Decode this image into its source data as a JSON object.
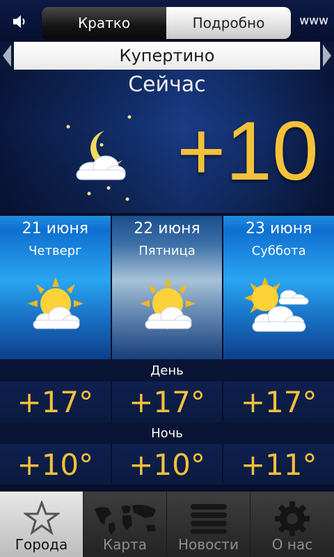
{
  "header": {
    "segments": [
      {
        "label": "Кратко",
        "active": true
      },
      {
        "label": "Подробно",
        "active": false
      }
    ],
    "www_label": "www",
    "sound_icon": "speaker-icon"
  },
  "city": "Купертино",
  "now": {
    "label": "Сейчас",
    "temperature": "+10",
    "icon": "moon-cloud-icon"
  },
  "forecast": [
    {
      "date": "21 июня",
      "weekday": "Четверг",
      "icon": "sun-cloud-icon",
      "selected": false
    },
    {
      "date": "22 июня",
      "weekday": "Пятница",
      "icon": "sun-cloud-icon",
      "selected": true
    },
    {
      "date": "23 июня",
      "weekday": "Суббота",
      "icon": "sun-clouds-icon",
      "selected": false
    }
  ],
  "day_label": "День",
  "day_temps": [
    "+17°",
    "+17°",
    "+17°"
  ],
  "night_label": "Ночь",
  "night_temps": [
    "+10°",
    "+10°",
    "+11°"
  ],
  "tabs": [
    {
      "label": "Города",
      "icon": "star-icon",
      "active": true
    },
    {
      "label": "Карта",
      "icon": "world-map-icon",
      "active": false
    },
    {
      "label": "Новости",
      "icon": "news-lines-icon",
      "active": false
    },
    {
      "label": "О нас",
      "icon": "gear-icon",
      "active": false
    }
  ],
  "colors": {
    "accent_temp": "#f4c13a",
    "background": "#06102a",
    "forecast_blue": "#1f8de0"
  }
}
